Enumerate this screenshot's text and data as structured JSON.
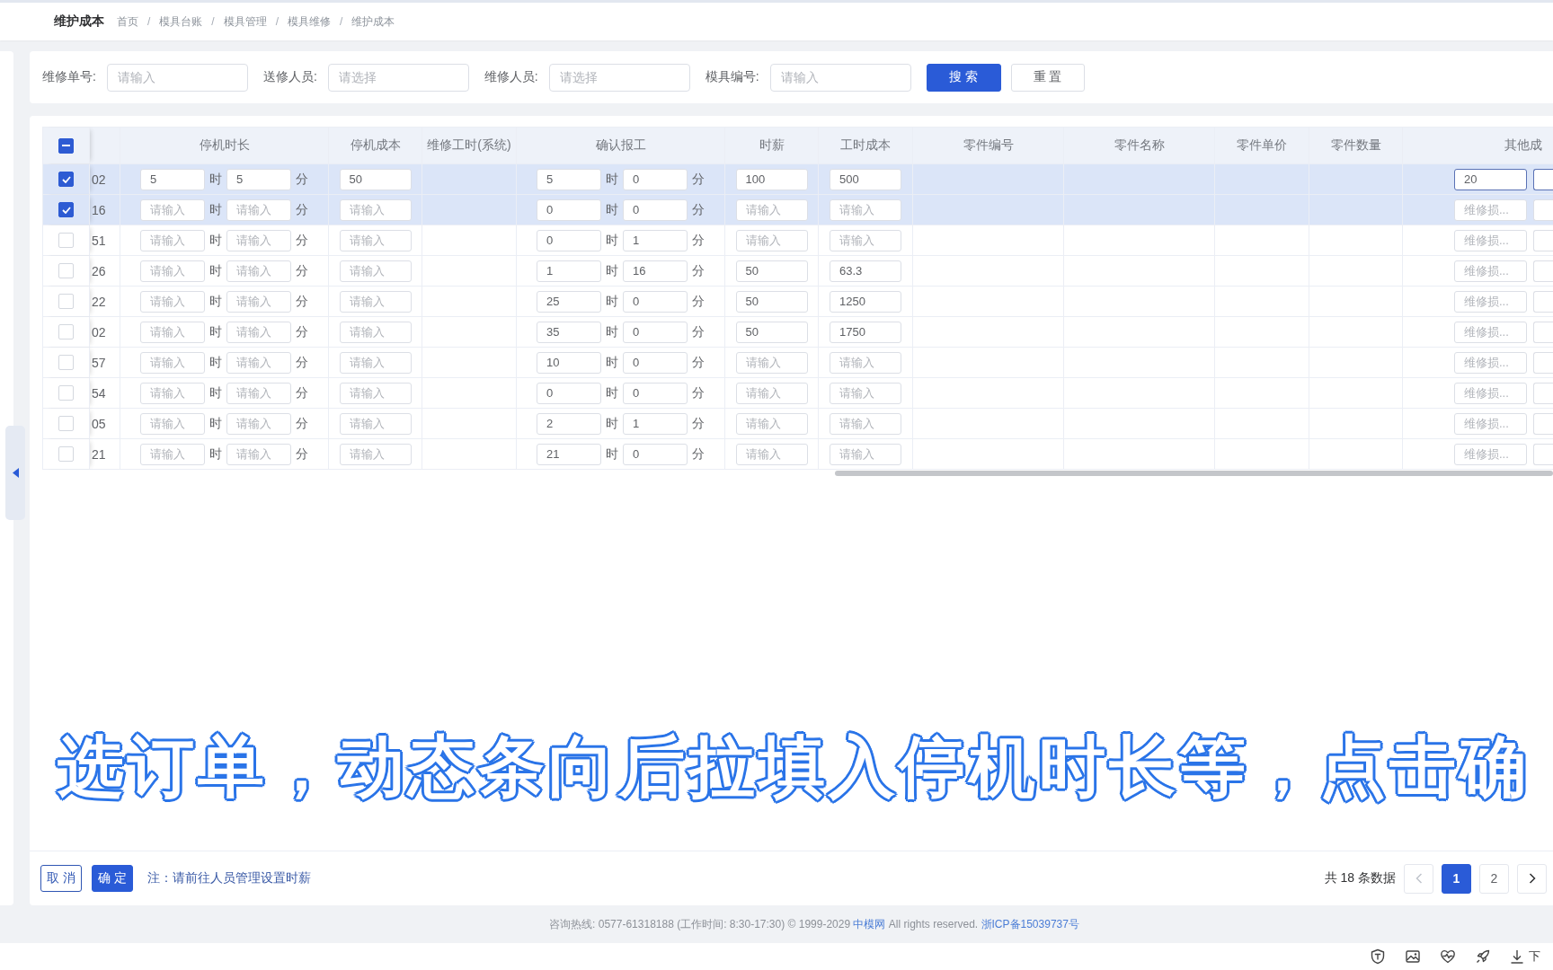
{
  "header": {
    "title": "维护成本",
    "breadcrumb": [
      {
        "kind": "link",
        "text": "首页"
      },
      {
        "kind": "separator",
        "text": "/"
      },
      {
        "kind": "link",
        "text": "模具台账"
      },
      {
        "kind": "separator",
        "text": "/"
      },
      {
        "kind": "link",
        "text": "模具管理"
      },
      {
        "kind": "separator",
        "text": "/"
      },
      {
        "kind": "link",
        "text": "模具维修"
      },
      {
        "kind": "separator",
        "text": "/"
      },
      {
        "kind": "current",
        "text": "维护成本"
      }
    ]
  },
  "search": {
    "fields": [
      {
        "label": "维修单号:",
        "placeholder": "请输入"
      },
      {
        "label": "送修人员:",
        "placeholder": "请选择"
      },
      {
        "label": "维修人员:",
        "placeholder": "请选择"
      },
      {
        "label": "模具编号:",
        "placeholder": "请输入"
      }
    ],
    "buttons": [
      {
        "kind": "primary",
        "label": "搜 索"
      },
      {
        "kind": "default",
        "label": "重 置"
      }
    ]
  },
  "table": {
    "select_all": {
      "indeterminate": true
    },
    "columns": [
      {
        "label": "停机时长"
      },
      {
        "label": "停机成本"
      },
      {
        "label": "维修工时(系统)"
      },
      {
        "label": "确认报工"
      },
      {
        "label": "时薪"
      },
      {
        "label": "工时成本"
      },
      {
        "label": "零件编号"
      },
      {
        "label": "零件名称"
      },
      {
        "label": "零件单价"
      },
      {
        "label": "零件数量"
      },
      {
        "label": "其他成"
      }
    ],
    "rows": [
      {
        "selected": true,
        "column_2": "02",
        "downtime": [
          {
            "kind": "field",
            "value": "5"
          },
          {
            "kind": "unit",
            "text": "时"
          },
          {
            "kind": "field",
            "value": "5"
          },
          {
            "kind": "unit",
            "text": "分"
          }
        ],
        "downtime_cost": {
          "value": "50"
        },
        "confirmed_work": [
          {
            "kind": "field",
            "value": "5"
          },
          {
            "kind": "unit",
            "text": "时"
          },
          {
            "kind": "field",
            "value": "0"
          },
          {
            "kind": "unit",
            "text": "分"
          }
        ],
        "hourly_wage": {
          "value": "100"
        },
        "labor_cost": {
          "value": "500"
        },
        "other_cost": [
          {
            "kind": "field",
            "value": "20",
            "focused": true
          },
          {
            "kind": "field",
            "focused": true
          }
        ]
      },
      {
        "selected": true,
        "column_2": "16",
        "downtime": [
          {
            "kind": "field",
            "placeholder": "请输入"
          },
          {
            "kind": "unit",
            "text": "时"
          },
          {
            "kind": "field",
            "placeholder": "请输入"
          },
          {
            "kind": "unit",
            "text": "分"
          }
        ],
        "downtime_cost": {
          "placeholder": "请输入"
        },
        "confirmed_work": [
          {
            "kind": "field",
            "value": "0"
          },
          {
            "kind": "unit",
            "text": "时"
          },
          {
            "kind": "field",
            "value": "0"
          },
          {
            "kind": "unit",
            "text": "分"
          }
        ],
        "hourly_wage": {
          "placeholder": "请输入"
        },
        "labor_cost": {
          "placeholder": "请输入"
        },
        "other_cost": [
          {
            "kind": "field",
            "placeholder": "维修损...",
            "focused": false
          },
          {
            "kind": "field",
            "focused": false
          }
        ]
      },
      {
        "selected": false,
        "column_2": "51",
        "downtime": [
          {
            "kind": "field",
            "placeholder": "请输入"
          },
          {
            "kind": "unit",
            "text": "时"
          },
          {
            "kind": "field",
            "placeholder": "请输入"
          },
          {
            "kind": "unit",
            "text": "分"
          }
        ],
        "downtime_cost": {
          "placeholder": "请输入"
        },
        "confirmed_work": [
          {
            "kind": "field",
            "value": "0"
          },
          {
            "kind": "unit",
            "text": "时"
          },
          {
            "kind": "field",
            "value": "1"
          },
          {
            "kind": "unit",
            "text": "分"
          }
        ],
        "hourly_wage": {
          "placeholder": "请输入"
        },
        "labor_cost": {
          "placeholder": "请输入"
        },
        "other_cost": [
          {
            "kind": "field",
            "placeholder": "维修损...",
            "focused": false
          },
          {
            "kind": "field",
            "focused": false
          }
        ]
      },
      {
        "selected": false,
        "column_2": "26",
        "downtime": [
          {
            "kind": "field",
            "placeholder": "请输入"
          },
          {
            "kind": "unit",
            "text": "时"
          },
          {
            "kind": "field",
            "placeholder": "请输入"
          },
          {
            "kind": "unit",
            "text": "分"
          }
        ],
        "downtime_cost": {
          "placeholder": "请输入"
        },
        "confirmed_work": [
          {
            "kind": "field",
            "value": "1"
          },
          {
            "kind": "unit",
            "text": "时"
          },
          {
            "kind": "field",
            "value": "16"
          },
          {
            "kind": "unit",
            "text": "分"
          }
        ],
        "hourly_wage": {
          "value": "50"
        },
        "labor_cost": {
          "value": "63.3"
        },
        "other_cost": [
          {
            "kind": "field",
            "placeholder": "维修损...",
            "focused": false
          },
          {
            "kind": "field",
            "focused": false
          }
        ]
      },
      {
        "selected": false,
        "column_2": "22",
        "downtime": [
          {
            "kind": "field",
            "placeholder": "请输入"
          },
          {
            "kind": "unit",
            "text": "时"
          },
          {
            "kind": "field",
            "placeholder": "请输入"
          },
          {
            "kind": "unit",
            "text": "分"
          }
        ],
        "downtime_cost": {
          "placeholder": "请输入"
        },
        "confirmed_work": [
          {
            "kind": "field",
            "value": "25"
          },
          {
            "kind": "unit",
            "text": "时"
          },
          {
            "kind": "field",
            "value": "0"
          },
          {
            "kind": "unit",
            "text": "分"
          }
        ],
        "hourly_wage": {
          "value": "50"
        },
        "labor_cost": {
          "value": "1250"
        },
        "other_cost": [
          {
            "kind": "field",
            "placeholder": "维修损...",
            "focused": false
          },
          {
            "kind": "field",
            "focused": false
          }
        ]
      },
      {
        "selected": false,
        "column_2": "02",
        "downtime": [
          {
            "kind": "field",
            "placeholder": "请输入"
          },
          {
            "kind": "unit",
            "text": "时"
          },
          {
            "kind": "field",
            "placeholder": "请输入"
          },
          {
            "kind": "unit",
            "text": "分"
          }
        ],
        "downtime_cost": {
          "placeholder": "请输入"
        },
        "confirmed_work": [
          {
            "kind": "field",
            "value": "35"
          },
          {
            "kind": "unit",
            "text": "时"
          },
          {
            "kind": "field",
            "value": "0"
          },
          {
            "kind": "unit",
            "text": "分"
          }
        ],
        "hourly_wage": {
          "value": "50"
        },
        "labor_cost": {
          "value": "1750"
        },
        "other_cost": [
          {
            "kind": "field",
            "placeholder": "维修损...",
            "focused": false
          },
          {
            "kind": "field",
            "focused": false
          }
        ]
      },
      {
        "selected": false,
        "column_2": "57",
        "downtime": [
          {
            "kind": "field",
            "placeholder": "请输入"
          },
          {
            "kind": "unit",
            "text": "时"
          },
          {
            "kind": "field",
            "placeholder": "请输入"
          },
          {
            "kind": "unit",
            "text": "分"
          }
        ],
        "downtime_cost": {
          "placeholder": "请输入"
        },
        "confirmed_work": [
          {
            "kind": "field",
            "value": "10"
          },
          {
            "kind": "unit",
            "text": "时"
          },
          {
            "kind": "field",
            "value": "0"
          },
          {
            "kind": "unit",
            "text": "分"
          }
        ],
        "hourly_wage": {
          "placeholder": "请输入"
        },
        "labor_cost": {
          "placeholder": "请输入"
        },
        "other_cost": [
          {
            "kind": "field",
            "placeholder": "维修损...",
            "focused": false
          },
          {
            "kind": "field",
            "focused": false
          }
        ]
      },
      {
        "selected": false,
        "column_2": "54",
        "downtime": [
          {
            "kind": "field",
            "placeholder": "请输入"
          },
          {
            "kind": "unit",
            "text": "时"
          },
          {
            "kind": "field",
            "placeholder": "请输入"
          },
          {
            "kind": "unit",
            "text": "分"
          }
        ],
        "downtime_cost": {
          "placeholder": "请输入"
        },
        "confirmed_work": [
          {
            "kind": "field",
            "value": "0"
          },
          {
            "kind": "unit",
            "text": "时"
          },
          {
            "kind": "field",
            "value": "0"
          },
          {
            "kind": "unit",
            "text": "分"
          }
        ],
        "hourly_wage": {
          "placeholder": "请输入"
        },
        "labor_cost": {
          "placeholder": "请输入"
        },
        "other_cost": [
          {
            "kind": "field",
            "placeholder": "维修损...",
            "focused": false
          },
          {
            "kind": "field",
            "focused": false
          }
        ]
      },
      {
        "selected": false,
        "column_2": "05",
        "downtime": [
          {
            "kind": "field",
            "placeholder": "请输入"
          },
          {
            "kind": "unit",
            "text": "时"
          },
          {
            "kind": "field",
            "placeholder": "请输入"
          },
          {
            "kind": "unit",
            "text": "分"
          }
        ],
        "downtime_cost": {
          "placeholder": "请输入"
        },
        "confirmed_work": [
          {
            "kind": "field",
            "value": "2"
          },
          {
            "kind": "unit",
            "text": "时"
          },
          {
            "kind": "field",
            "value": "1"
          },
          {
            "kind": "unit",
            "text": "分"
          }
        ],
        "hourly_wage": {
          "placeholder": "请输入"
        },
        "labor_cost": {
          "placeholder": "请输入"
        },
        "other_cost": [
          {
            "kind": "field",
            "placeholder": "维修损...",
            "focused": false
          },
          {
            "kind": "field",
            "focused": false
          }
        ]
      },
      {
        "selected": false,
        "column_2": "21",
        "downtime": [
          {
            "kind": "field",
            "placeholder": "请输入"
          },
          {
            "kind": "unit",
            "text": "时"
          },
          {
            "kind": "field",
            "placeholder": "请输入"
          },
          {
            "kind": "unit",
            "text": "分"
          }
        ],
        "downtime_cost": {
          "placeholder": "请输入"
        },
        "confirmed_work": [
          {
            "kind": "field",
            "value": "21"
          },
          {
            "kind": "unit",
            "text": "时"
          },
          {
            "kind": "field",
            "value": "0"
          },
          {
            "kind": "unit",
            "text": "分"
          }
        ],
        "hourly_wage": {
          "placeholder": "请输入"
        },
        "labor_cost": {
          "placeholder": "请输入"
        },
        "other_cost": [
          {
            "kind": "field",
            "placeholder": "维修损...",
            "focused": false
          },
          {
            "kind": "field",
            "focused": false
          }
        ]
      }
    ]
  },
  "footer_actions": {
    "buttons": [
      {
        "kind": "outline",
        "label": "取 消"
      },
      {
        "kind": "primary",
        "label": "确 定"
      }
    ],
    "note": "注：请前往人员管理设置时薪"
  },
  "pagination": {
    "total": "共 18 条数据",
    "prev": {
      "disabled": true
    },
    "pages": [
      {
        "label": "1",
        "selected": true
      },
      {
        "label": "2",
        "selected": false
      }
    ],
    "next": {
      "disabled": false
    }
  },
  "site_footer": {
    "parts": [
      {
        "kind": "text",
        "text": "咨询热线: 0577-61318188 (工作时间: 8:30-17:30) © 1999-2029"
      },
      {
        "kind": "link",
        "text": "中模网"
      },
      {
        "kind": "text",
        "text": "All rights reserved."
      },
      {
        "kind": "link",
        "text": "浙ICP备15039737号"
      }
    ]
  },
  "caption": {
    "text": "选订单，动态条向后拉填入停机时长等，点击确"
  },
  "bottom_bar": {
    "download_label": "下"
  }
}
